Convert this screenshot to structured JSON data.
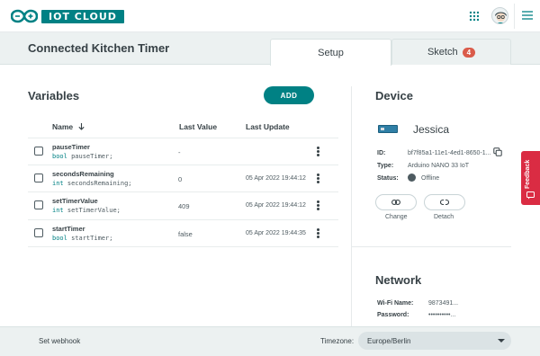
{
  "header": {
    "brand": "IOT CLOUD",
    "icons": [
      "infinity-logo-icon",
      "apps-grid-icon",
      "user-avatar-icon",
      "hamburger-menu-icon"
    ]
  },
  "page": {
    "title": "Connected Kitchen Timer",
    "tabs": [
      {
        "label": "Setup",
        "active": true
      },
      {
        "label": "Sketch",
        "badge": "4",
        "active": false
      }
    ]
  },
  "variables": {
    "title": "Variables",
    "add_label": "ADD",
    "columns": {
      "name": "Name",
      "sort_icon": "arrow-down-icon",
      "last_value": "Last Value",
      "last_update": "Last Update"
    },
    "rows": [
      {
        "name": "pauseTimer",
        "type": "bool",
        "decl": "pauseTimer;",
        "value": "-",
        "updated": ""
      },
      {
        "name": "secondsRemaining",
        "type": "int",
        "decl": "secondsRemaining;",
        "value": "0",
        "updated": "05 Apr 2022 19:44:12"
      },
      {
        "name": "setTimerValue",
        "type": "int",
        "decl": "setTimerValue;",
        "value": "409",
        "updated": "05 Apr 2022 19:44:12"
      },
      {
        "name": "startTimer",
        "type": "bool",
        "decl": "startTimer;",
        "value": "false",
        "updated": "05 Apr 2022 19:44:35"
      }
    ]
  },
  "device": {
    "title": "Device",
    "name": "Jessica",
    "id_label": "ID:",
    "id_value": "bf7f85a1-11e1-4ed1-8650-1...",
    "type_label": "Type:",
    "type_value": "Arduino NANO 33 IoT",
    "status_label": "Status:",
    "status_value": "Offline",
    "change_label": "Change",
    "detach_label": "Detach"
  },
  "network": {
    "title": "Network",
    "wifi_label": "Wi-Fi Name:",
    "wifi_value": "9873491...",
    "password_label": "Password:",
    "password_value": "••••••••••..."
  },
  "feedback": {
    "label": "Feedback"
  },
  "footer": {
    "webhook_label": "Set webhook",
    "timezone_label": "Timezone:",
    "timezone_value": "Europe/Berlin"
  },
  "colors": {
    "accent": "#008184",
    "badge": "#da5b4a",
    "feedback": "#da2c43",
    "band": "#ecf1f1"
  }
}
